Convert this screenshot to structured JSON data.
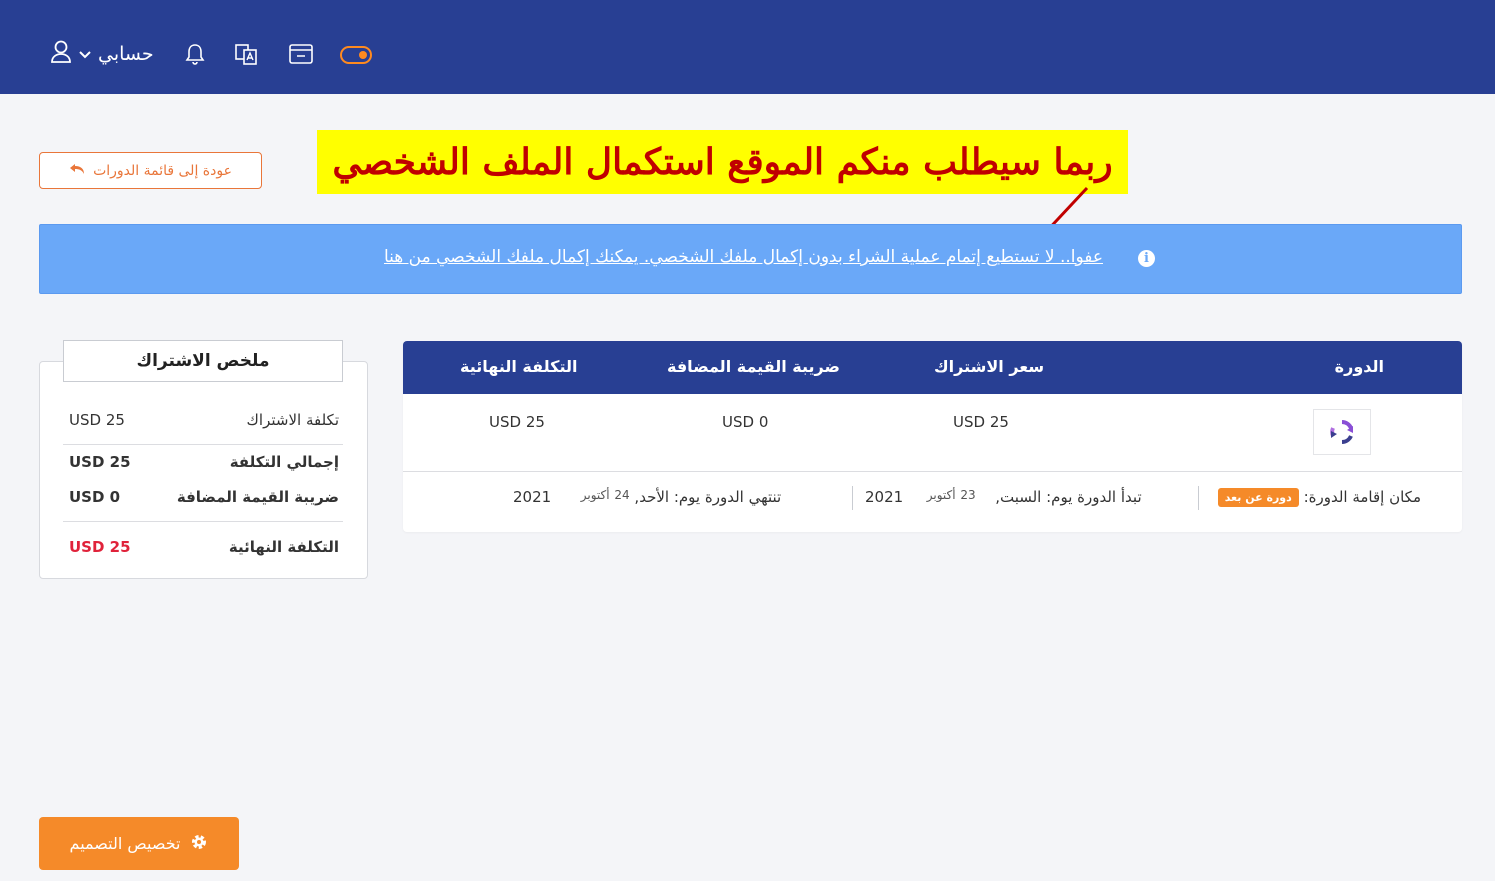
{
  "header": {
    "account_label": "حسابي",
    "icons": [
      "user-icon",
      "chevron-down-icon",
      "bell-icon",
      "translate-icon",
      "window-icon",
      "theme-toggle"
    ]
  },
  "back_button": {
    "label": "عودة إلى قائمة الدورات"
  },
  "annotation": {
    "text": "ربما سيطلب منكم الموقع استكمال الملف الشخصي"
  },
  "alert": {
    "message": "عفوا.. لا تستطيع إتمام عملية الشراء بدون إكمال ملفك الشخصي. يمكنك إكمال ملفك الشخصي من هنا"
  },
  "summary": {
    "title": "ملخص الاشتراك",
    "rows": [
      {
        "name": "تكلفة الاشتراك",
        "value": "USD 25"
      },
      {
        "name": "إجمالي التكلفة",
        "value": "USD 25"
      },
      {
        "name": "ضريبة القيمة المضافة",
        "value": "USD 0"
      },
      {
        "name": "التكلفة النهائية",
        "value": "USD 25"
      }
    ]
  },
  "table": {
    "headers": [
      "الدورة",
      "سعر الاشتراك",
      "ضريبة القيمة المضافة",
      "التكلفة النهائية"
    ],
    "row": {
      "price": "USD 25",
      "vat": "USD 0",
      "final": "USD 25"
    },
    "details": {
      "location_label": "مكان إقامة الدورة:",
      "location_badge": "دورة عن بعد",
      "start_label": "تبدأ الدورة يوم: السبت,",
      "start_day": "23",
      "start_month": "أكتوبر",
      "start_year": "2021",
      "end_label": "تنتهي الدورة يوم: الأحد,",
      "end_day": "24",
      "end_month": "أكتوبر",
      "end_year": "2021"
    }
  },
  "customize_button": {
    "label": "تخصيص التصميم"
  },
  "colors": {
    "header": "#283f93",
    "accent": "#f58a29",
    "alert": "#6aa8f8",
    "annotation_bg": "#ffff00",
    "annotation_text": "#c00000"
  }
}
